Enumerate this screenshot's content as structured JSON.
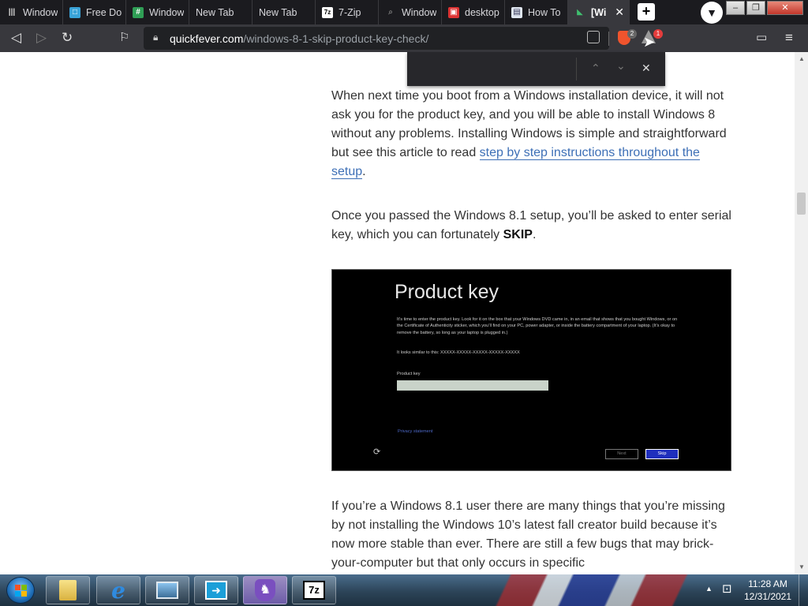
{
  "tabs": [
    {
      "label": "Window",
      "icon": "columns-icon"
    },
    {
      "label": "Free Do",
      "icon": "doc-icon"
    },
    {
      "label": "Window",
      "icon": "grid-icon"
    },
    {
      "label": "New Tab",
      "icon": ""
    },
    {
      "label": "New Tab",
      "icon": ""
    },
    {
      "label": "7-Zip",
      "icon": "7z-icon"
    },
    {
      "label": "Window",
      "icon": "search-icon"
    },
    {
      "label": "desktop",
      "icon": "red-app-icon"
    },
    {
      "label": "How To",
      "icon": "doc-icon"
    },
    {
      "label": "[Wi",
      "icon": "site-favicon",
      "active": true
    }
  ],
  "tab_close_glyph": "✕",
  "new_tab_glyph": "+",
  "window_controls": {
    "minimize": "–",
    "restore": "❐",
    "close": "✕"
  },
  "url": {
    "domain": "quickfever.com",
    "path": "/windows-8-1-skip-product-key-check/"
  },
  "shields_badge": "2",
  "rewards_badge": "1",
  "find_bar": {
    "query": "",
    "prev": "⌃",
    "next": "⌄",
    "close": "✕"
  },
  "article": {
    "para1_before": "When next time you boot from a Windows installation device, it will not ask you for the product key, and you will be able to install Windows 8 without any problems. Installing Windows is simple and straightforward but see this article to read ",
    "para1_link": "step by step instructions throughout the setup",
    "para1_after": ".",
    "para2_before": "Once you passed the Windows 8.1 setup, you’ll be asked to enter serial key, which you can fortunately ",
    "para2_bold": "SKIP",
    "para2_after": ".",
    "para3": "If you’re a Windows 8.1 user there are many things that you’re missing by not installing the Windows 10’s latest fall creator build because it’s now more stable than ever. There are still a few bugs that may brick-your-computer but that only occurs in specific"
  },
  "product_key_screen": {
    "title": "Product key",
    "body": "It’s time to enter the product key. Look for it on the box that your Windows DVD came in, in an email that shows that you bought Windows, or on the Certificate of Authenticity sticker, which you’ll find on your PC, power adapter, or inside the battery compartment of your laptop. (It’s okay to remove the battery, so long as your laptop is plugged in.)",
    "hint": "It looks similar to this: XXXXX-XXXXX-XXXXX-XXXXX-XXXXX",
    "field_label": "Product key",
    "privacy": "Privacy statement",
    "next": "Next",
    "skip": "Skip"
  },
  "taskbar": {
    "apps": [
      "folder-icon",
      "ie-icon",
      "desktop-icon",
      "remote-icon",
      "brave-icon",
      "7zip-icon"
    ],
    "time": "11:28 AM",
    "date": "12/31/2021"
  }
}
